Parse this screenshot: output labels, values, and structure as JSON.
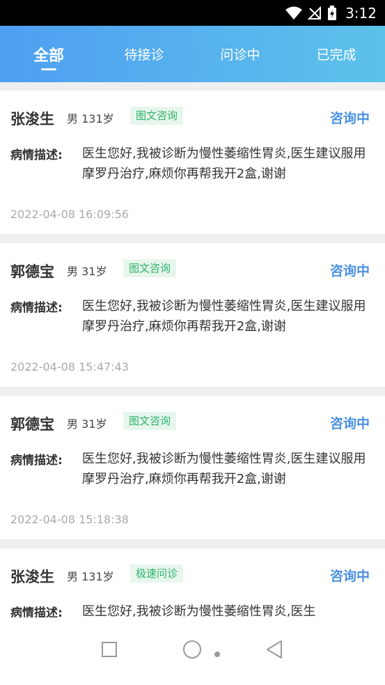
{
  "status_bar": {
    "time": "3:12"
  },
  "tabs": [
    {
      "label": "全部",
      "active": true
    },
    {
      "label": "待接诊",
      "active": false
    },
    {
      "label": "问诊中",
      "active": false
    },
    {
      "label": "已完成",
      "active": false
    }
  ],
  "cards": [
    {
      "name": "张浚生",
      "meta": "男 131岁",
      "tag": "图文咨询",
      "status": "咨询中",
      "desc_label": "病情描述:",
      "desc": "医生您好,我被诊断为慢性萎缩性胃炎,医生建议服用摩罗丹治疗,麻烦你再帮我开2盒,谢谢",
      "time": "2022-04-08 16:09:56"
    },
    {
      "name": "郭德宝",
      "meta": "男 31岁",
      "tag": "图文咨询",
      "status": "咨询中",
      "desc_label": "病情描述:",
      "desc": "医生您好,我被诊断为慢性萎缩性胃炎,医生建议服用摩罗丹治疗,麻烦你再帮我开2盒,谢谢",
      "time": "2022-04-08 15:47:43"
    },
    {
      "name": "郭德宝",
      "meta": "男 31岁",
      "tag": "图文咨询",
      "status": "咨询中",
      "desc_label": "病情描述:",
      "desc": "医生您好,我被诊断为慢性萎缩性胃炎,医生建议服用摩罗丹治疗,麻烦你再帮我开2盒,谢谢",
      "time": "2022-04-08 15:18:38"
    },
    {
      "name": "张浚生",
      "meta": "男 131岁",
      "tag": "极速问诊",
      "status": "咨询中",
      "desc_label": "病情描述:",
      "desc": "医生您好,我被诊断为慢性萎缩性胃炎,医生",
      "time": ""
    }
  ],
  "colors": {
    "accent": "#4a90e2",
    "tag_green": "#2fb26b",
    "tab_gradient_start": "#4f9ff2",
    "tab_gradient_end": "#5dc2ea"
  },
  "icons": {
    "wifi": "wifi-icon",
    "signal": "no-signal-icon",
    "battery": "battery-charging-icon",
    "recent": "square-icon",
    "home": "circle-icon",
    "back": "triangle-back-icon"
  }
}
